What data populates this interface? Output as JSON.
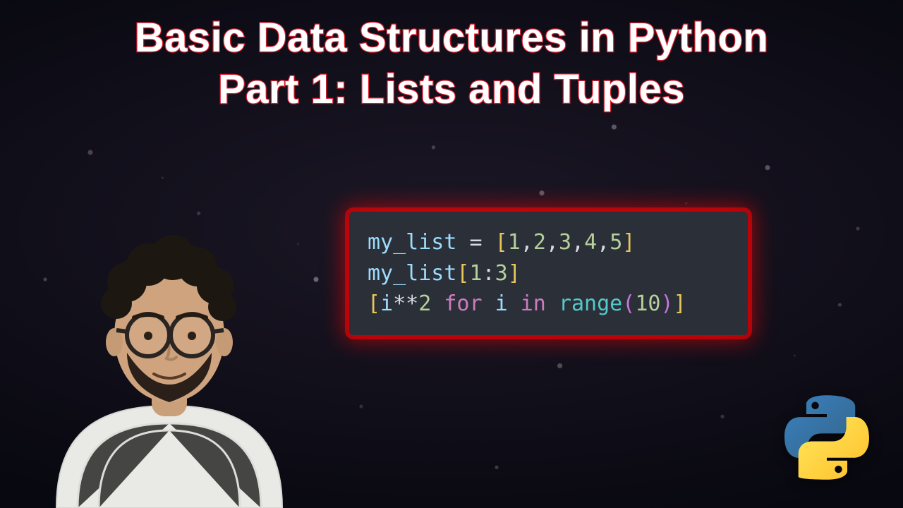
{
  "title": {
    "line1": "Basic Data Structures in Python",
    "line2": "Part 1: Lists and Tuples"
  },
  "code": {
    "lines": [
      [
        {
          "t": "my_list",
          "c": "var"
        },
        {
          "t": " ",
          "c": "op"
        },
        {
          "t": "=",
          "c": "op"
        },
        {
          "t": " ",
          "c": "op"
        },
        {
          "t": "[",
          "c": "brack"
        },
        {
          "t": "1",
          "c": "num"
        },
        {
          "t": ",",
          "c": "punc"
        },
        {
          "t": "2",
          "c": "num"
        },
        {
          "t": ",",
          "c": "punc"
        },
        {
          "t": "3",
          "c": "num"
        },
        {
          "t": ",",
          "c": "punc"
        },
        {
          "t": "4",
          "c": "num"
        },
        {
          "t": ",",
          "c": "punc"
        },
        {
          "t": "5",
          "c": "num"
        },
        {
          "t": "]",
          "c": "brack"
        }
      ],
      [
        {
          "t": "my_list",
          "c": "var"
        },
        {
          "t": "[",
          "c": "brack"
        },
        {
          "t": "1",
          "c": "num"
        },
        {
          "t": ":",
          "c": "punc"
        },
        {
          "t": "3",
          "c": "num"
        },
        {
          "t": "]",
          "c": "brack"
        }
      ],
      [
        {
          "t": "[",
          "c": "brack"
        },
        {
          "t": "i",
          "c": "var"
        },
        {
          "t": "**",
          "c": "op"
        },
        {
          "t": "2",
          "c": "num"
        },
        {
          "t": " ",
          "c": "op"
        },
        {
          "t": "for",
          "c": "kw"
        },
        {
          "t": " ",
          "c": "op"
        },
        {
          "t": "i",
          "c": "var"
        },
        {
          "t": " ",
          "c": "op"
        },
        {
          "t": "in",
          "c": "kw"
        },
        {
          "t": " ",
          "c": "op"
        },
        {
          "t": "range",
          "c": "fn"
        },
        {
          "t": "(",
          "c": "paren"
        },
        {
          "t": "10",
          "c": "num"
        },
        {
          "t": ")",
          "c": "paren"
        },
        {
          "t": "]",
          "c": "brack"
        }
      ]
    ]
  },
  "icons": {
    "python": "python-logo-icon",
    "presenter": "presenter-photo"
  },
  "colors": {
    "title_fill": "#ffffff",
    "title_stroke": "#e11d2e",
    "code_bg": "#2b2f38",
    "code_glow": "#ff0000"
  }
}
